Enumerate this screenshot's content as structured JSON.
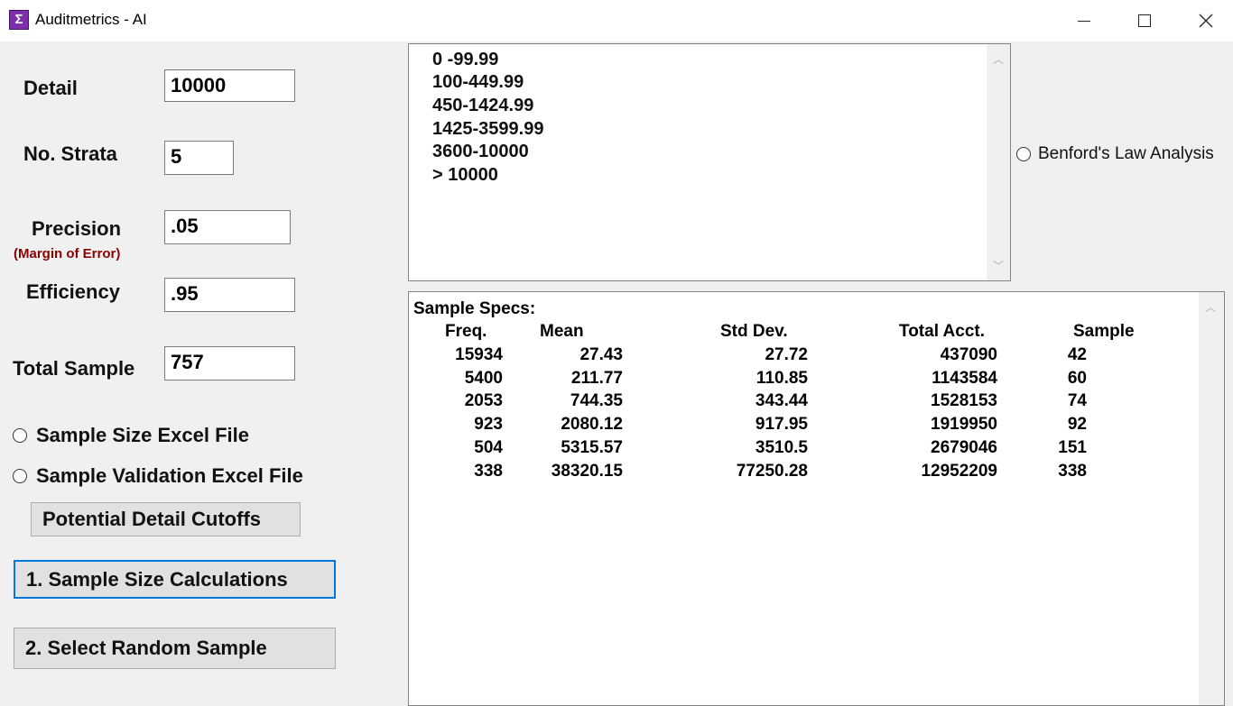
{
  "window": {
    "title": "Auditmetrics - AI",
    "app_icon_glyph": "Σ",
    "controls": [
      "minimize-icon",
      "maximize-icon",
      "close-icon"
    ]
  },
  "form": {
    "detail_label": "Detail",
    "detail_value": "10000",
    "strata_label": "No. Strata",
    "strata_value": "5",
    "precision_label": "Precision",
    "precision_note": "(Margin of Error)",
    "precision_value": ".05",
    "efficiency_label": "Efficiency",
    "efficiency_value": ".95",
    "total_sample_label": "Total Sample",
    "total_sample_value": "757"
  },
  "options": {
    "sample_size_excel": "Sample Size Excel File",
    "sample_validation_excel": "Sample Validation Excel File",
    "benford": "Benford's Law Analysis"
  },
  "buttons": {
    "cutoffs": "Potential Detail Cutoffs",
    "calc": "1. Sample Size Calculations",
    "select": "2. Select Random Sample"
  },
  "strata_ranges": [
    "0 -99.99",
    "100-449.99",
    "450-1424.99",
    "1425-3599.99",
    "3600-10000",
    "> 10000"
  ],
  "specs": {
    "title": "Sample Specs:",
    "headers": [
      "Freq.",
      "Mean",
      "Std Dev.",
      "Total Acct.",
      "Sample"
    ],
    "rows": [
      [
        "15934",
        "27.43",
        "27.72",
        "437090",
        "42"
      ],
      [
        "5400",
        "211.77",
        "110.85",
        "1143584",
        "60"
      ],
      [
        "2053",
        "744.35",
        "343.44",
        "1528153",
        "74"
      ],
      [
        "923",
        "2080.12",
        "917.95",
        "1919950",
        "92"
      ],
      [
        "504",
        "5315.57",
        "3510.5",
        "2679046",
        "151"
      ],
      [
        "338",
        "38320.15",
        "77250.28",
        "12952209",
        "338"
      ]
    ]
  },
  "colors": {
    "note_red": "#8b0000",
    "focus_blue": "#0078d7",
    "icon_purple": "#7b2fa8"
  }
}
